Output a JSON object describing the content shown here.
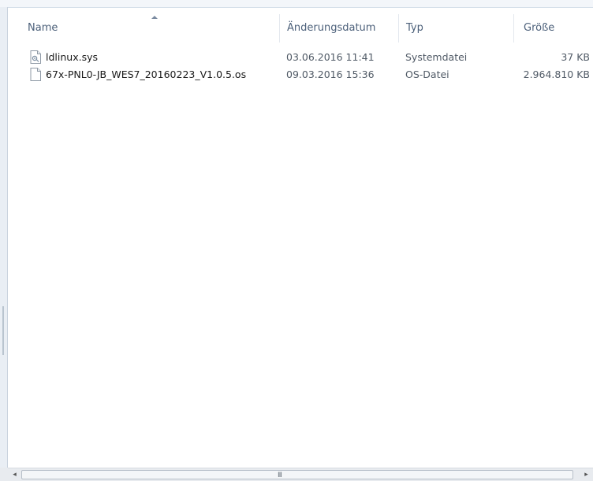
{
  "columns": {
    "name": "Name",
    "date": "Änderungsdatum",
    "type": "Typ",
    "size": "Größe"
  },
  "files": [
    {
      "name": "ldlinux.sys",
      "date": "03.06.2016 11:41",
      "type": "Systemdatei",
      "size": "37 KB",
      "icon": "system-file-icon"
    },
    {
      "name": "67x-PNL0-JB_WES7_20160223_V1.0.5.os",
      "date": "09.03.2016 15:36",
      "type": "OS-Datei",
      "size": "2.964.810 KB",
      "icon": "generic-file-icon"
    }
  ],
  "scrollbar": {
    "left_arrow": "◂",
    "right_arrow": "▸",
    "grip": "III"
  },
  "colors": {
    "header_text": "#4c607a",
    "row_text": "#1e1e1e",
    "meta_text": "#505a66"
  }
}
